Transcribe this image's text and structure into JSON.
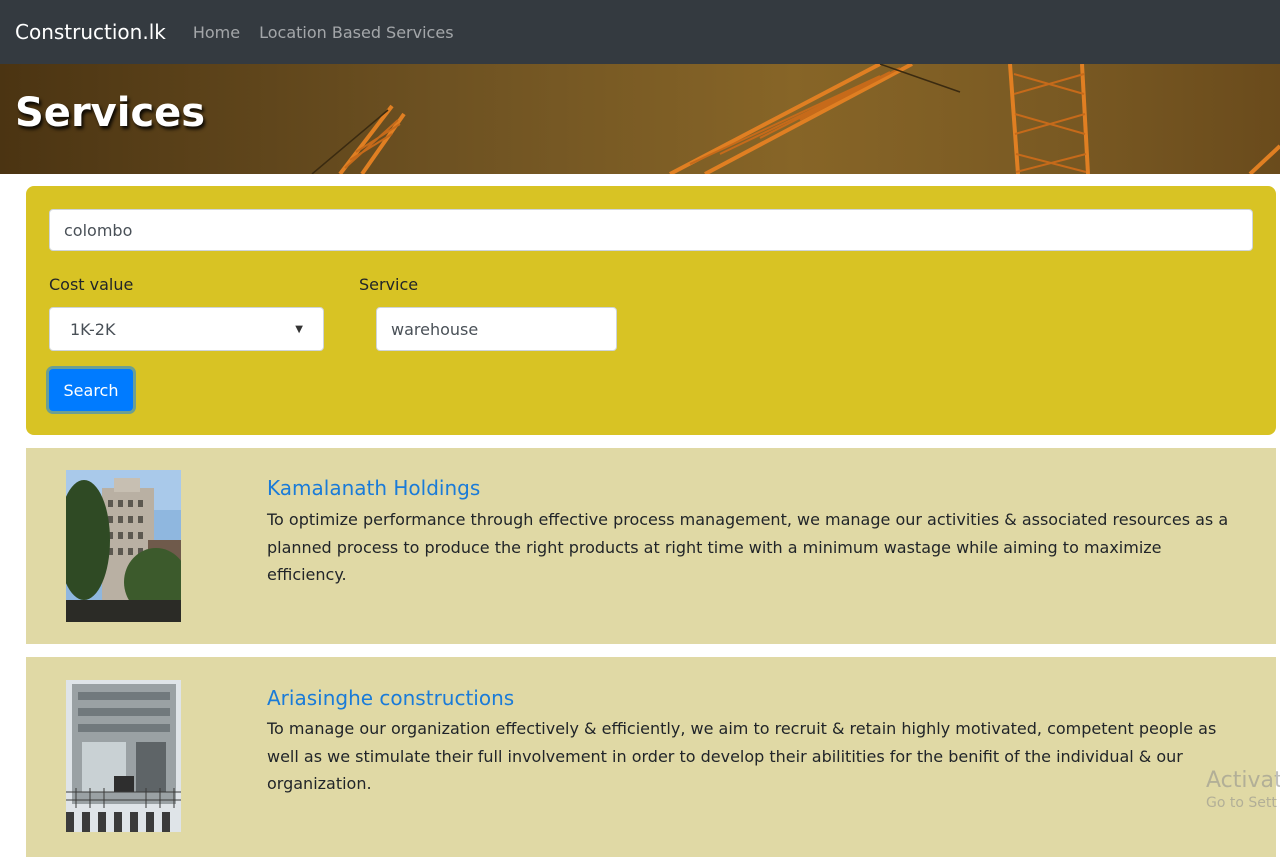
{
  "navbar": {
    "brand": "Construction.lk",
    "links": [
      "Home",
      "Location Based Services"
    ]
  },
  "hero": {
    "title": "Services"
  },
  "search": {
    "location_value": "colombo",
    "cost_label": "Cost value",
    "cost_selected": "1K-2K",
    "service_label": "Service",
    "service_value": "warehouse",
    "button_label": "Search"
  },
  "results": [
    {
      "name": "Kamalanath Holdings",
      "description": "To optimize performance through effective process management, we manage our activities & associated resources as a planned process to produce the right products at right time with a minimum wastage while aiming to maximize efficiency."
    },
    {
      "name": "Ariasinghe constructions",
      "description": "To manage our organization effectively & efficiently, we aim to recruit & retain highly motivated, competent people as well as we stimulate their full involvement in order to develop their abilitities for the benifit of the individual & our organization."
    }
  ],
  "watermark": {
    "line1": "Activate",
    "line2": "Go to Sett"
  },
  "colors": {
    "navbar": "#343a40",
    "search_panel": "#d8c324",
    "result_card": "#e0d9a5",
    "link": "#1a7bd8",
    "primary_button": "#007bff"
  }
}
